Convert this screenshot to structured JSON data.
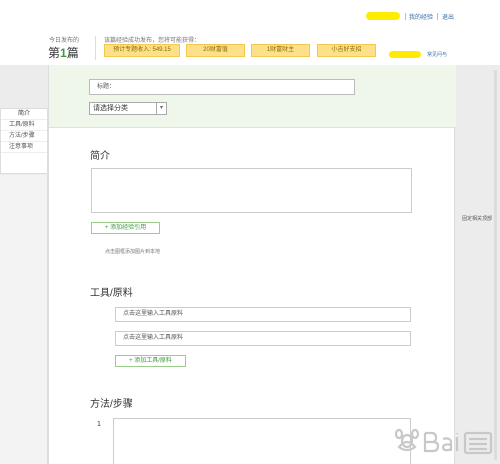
{
  "topbar": {
    "my_experience": "我的经验",
    "logout": "退出"
  },
  "header": {
    "today_label": "今日发布的",
    "today_count_prefix": "第",
    "today_count_num": "1",
    "today_count_suffix": "篇",
    "notice": "该篇经验成功发布，您将可能获得：",
    "chips": [
      "预计专题收入: 549.15",
      "20财富值",
      "1财富财主",
      "小吉好支招"
    ],
    "help": "常见问与"
  },
  "sidebar": {
    "items": [
      "简介",
      "工具/原料",
      "方法/步骤",
      "注意事项"
    ]
  },
  "title_area": {
    "title_placeholder": "标题：",
    "category": "请选择分类",
    "category_arrow": "▾"
  },
  "intro": {
    "heading": "简介",
    "add_button": "+ 添加经验引用",
    "hint": "点击图框添加图片到本地"
  },
  "tools": {
    "heading": "工具/原料",
    "inputs": [
      "点击这里输入工具原料",
      "点击这里输入工具原料"
    ],
    "add_button": "+ 添加工具/原料"
  },
  "steps": {
    "heading": "方法/步骤",
    "first_num": "1"
  },
  "side_note": "固定相关顶部"
}
